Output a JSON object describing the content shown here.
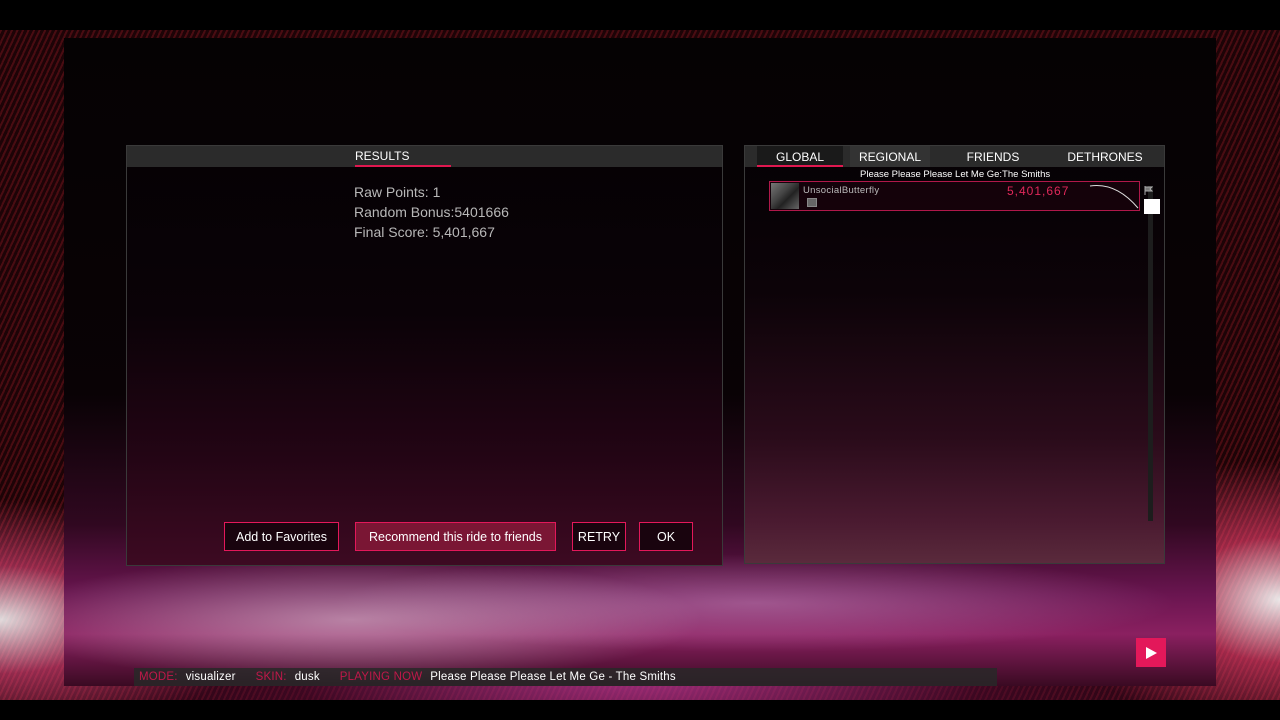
{
  "results": {
    "tab_label": "RESULTS",
    "raw_points": "Raw Points: 1",
    "random_bonus": "Random Bonus:5401666",
    "final_score": "Final Score: 5,401,667",
    "buttons": {
      "favorites": "Add to Favorites",
      "recommend": "Recommend this ride to friends",
      "retry": "RETRY",
      "ok": "OK"
    }
  },
  "leaderboard": {
    "tabs": [
      "GLOBAL",
      "REGIONAL",
      "FRIENDS",
      "DETHRONES"
    ],
    "active_tab": "GLOBAL",
    "song_caption": "Please Please Please Let Me Ge:The Smiths",
    "entries": [
      {
        "name": "UnsocialButterfly",
        "score": "5,401,667"
      }
    ]
  },
  "status_bar": {
    "mode_key": "MODE:",
    "mode_val": "visualizer",
    "skin_key": "SKIN:",
    "skin_val": "dusk",
    "playing_key": "PLAYING NOW",
    "playing_val": "Please Please Please Let Me Ge - The Smiths"
  },
  "colors": {
    "accent": "#e3185a",
    "panel_header": "#2b2b2b"
  }
}
